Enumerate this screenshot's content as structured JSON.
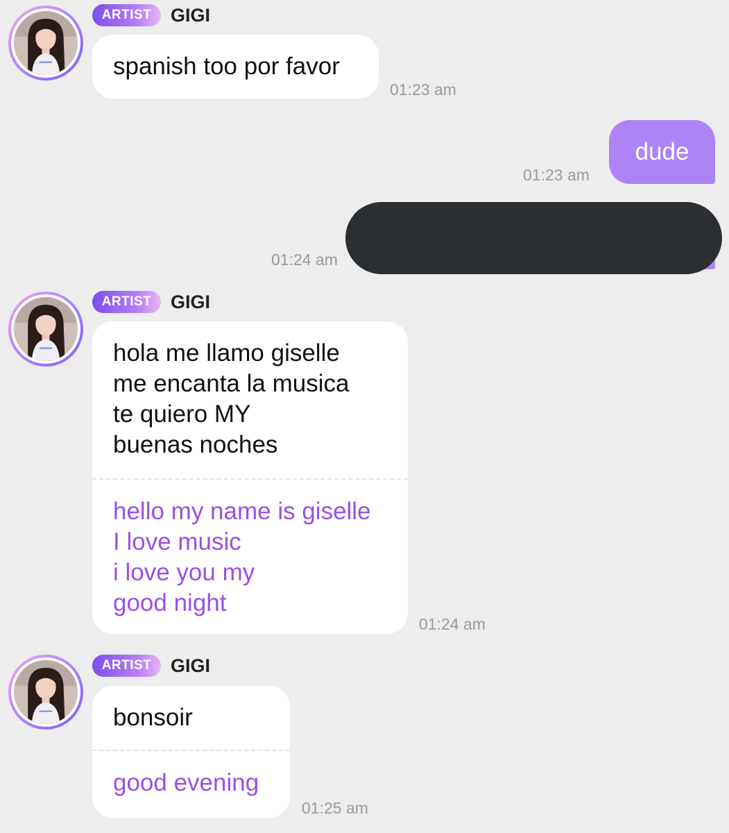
{
  "badge_label": "ARTIST",
  "sender_name": "GIGI",
  "messages": [
    {
      "text": "spanish too por favor",
      "time": "01:23 am"
    },
    {
      "text": "dude",
      "time": "01:23 am"
    },
    {
      "time": "01:24 am"
    },
    {
      "original_lines": [
        "hola me llamo giselle",
        "me encanta la musica",
        "te quiero MY",
        "buenas noches"
      ],
      "translation_lines": [
        "hello my name is giselle",
        "I love music",
        "i love you my",
        "good night"
      ],
      "time": "01:24 am"
    },
    {
      "original_lines": [
        "bonsoir"
      ],
      "translation_lines": [
        "good evening"
      ],
      "time": "01:25 am"
    }
  ],
  "colors": {
    "background": "#ededed",
    "outgoing_bubble": "#ad84f5",
    "translation_text": "#9a4fe6",
    "redaction": "#2b2e33"
  }
}
